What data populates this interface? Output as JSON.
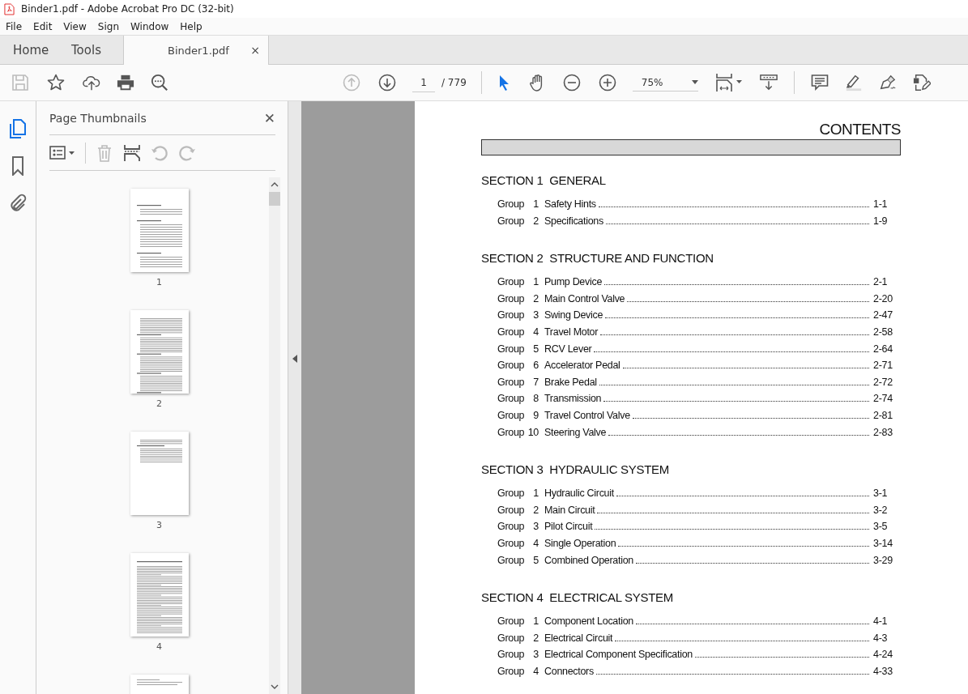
{
  "window": {
    "title": "Binder1.pdf - Adobe Acrobat Pro DC (32-bit)"
  },
  "menu": [
    "File",
    "Edit",
    "View",
    "Sign",
    "Window",
    "Help"
  ],
  "tabs": [
    {
      "label": "Home",
      "selected": false,
      "kind": "nav"
    },
    {
      "label": "Tools",
      "selected": false,
      "kind": "nav"
    },
    {
      "label": "Binder1.pdf",
      "selected": true,
      "kind": "document",
      "close": "×"
    }
  ],
  "toolbar": {
    "page_current": "1",
    "page_total": "/ 779",
    "zoom": "75%"
  },
  "sidebar": {
    "title": "Page Thumbnails",
    "close": "✕",
    "thumbnails": [
      {
        "label": "1",
        "kind": "contents"
      },
      {
        "label": "2",
        "kind": "list"
      },
      {
        "label": "3",
        "kind": "short"
      },
      {
        "label": "4",
        "kind": "text"
      },
      {
        "kind": "partial"
      }
    ]
  },
  "document": {
    "heading": "CONTENTS",
    "sections": [
      {
        "title": "SECTION 1  GENERAL",
        "entries": [
          {
            "group": "Group",
            "number": "1",
            "title": "Safety Hints",
            "page": "1-1"
          },
          {
            "group": "Group",
            "number": "2",
            "title": "Specifications",
            "page": "1-9"
          }
        ]
      },
      {
        "title": "SECTION 2  STRUCTURE AND FUNCTION",
        "entries": [
          {
            "group": "Group",
            "number": "1",
            "title": "Pump Device",
            "page": "2-1"
          },
          {
            "group": "Group",
            "number": "2",
            "title": "Main Control Valve",
            "page": "2-20"
          },
          {
            "group": "Group",
            "number": "3",
            "title": "Swing Device",
            "page": "2-47"
          },
          {
            "group": "Group",
            "number": "4",
            "title": "Travel Motor",
            "page": "2-58"
          },
          {
            "group": "Group",
            "number": "5",
            "title": "RCV Lever",
            "page": "2-64"
          },
          {
            "group": "Group",
            "number": "6",
            "title": "Accelerator Pedal",
            "page": "2-71"
          },
          {
            "group": "Group",
            "number": "7",
            "title": "Brake Pedal",
            "page": "2-72"
          },
          {
            "group": "Group",
            "number": "8",
            "title": "Transmission",
            "page": "2-74"
          },
          {
            "group": "Group",
            "number": "9",
            "title": "Travel Control Valve",
            "page": "2-81"
          },
          {
            "group": "Group",
            "number": "10",
            "title": "Steering Valve",
            "page": "2-83"
          }
        ]
      },
      {
        "title": "SECTION 3  HYDRAULIC SYSTEM",
        "entries": [
          {
            "group": "Group",
            "number": "1",
            "title": "Hydraulic Circuit",
            "page": "3-1"
          },
          {
            "group": "Group",
            "number": "2",
            "title": "Main Circuit",
            "page": "3-2"
          },
          {
            "group": "Group",
            "number": "3",
            "title": "Pilot Circuit",
            "page": "3-5"
          },
          {
            "group": "Group",
            "number": "4",
            "title": "Single Operation",
            "page": "3-14"
          },
          {
            "group": "Group",
            "number": "5",
            "title": "Combined Operation",
            "page": "3-29"
          }
        ]
      },
      {
        "title": "SECTION 4  ELECTRICAL SYSTEM",
        "entries": [
          {
            "group": "Group",
            "number": "1",
            "title": "Component Location",
            "page": "4-1"
          },
          {
            "group": "Group",
            "number": "2",
            "title": "Electrical Circuit",
            "page": "4-3"
          },
          {
            "group": "Group",
            "number": "3",
            "title": "Electrical Component Specification",
            "page": "4-24"
          },
          {
            "group": "Group",
            "number": "4",
            "title": "Connectors",
            "page": "4-33"
          }
        ]
      }
    ]
  }
}
